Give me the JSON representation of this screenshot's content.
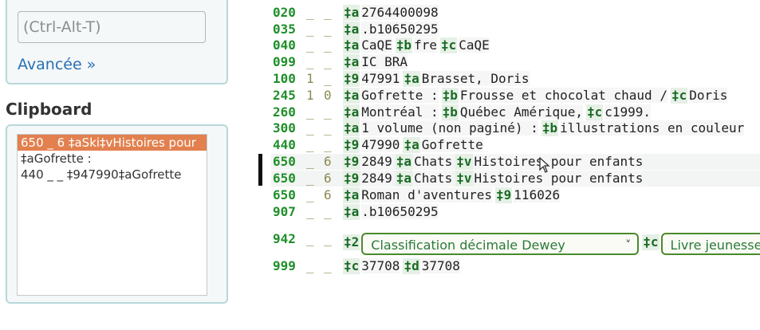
{
  "sidebar": {
    "search_placeholder": "(Ctrl-Alt-T)",
    "advanced_link": "Avancée »",
    "clipboard_title": "Clipboard",
    "clipboard_items": [
      "650 _ 6 ‡aSki‡vHistoires pour",
      "‡aGofrette :",
      "440 _ _ ‡947990‡aGofrette"
    ]
  },
  "editor": {
    "rows": [
      {
        "tag": "020",
        "ind1": "_",
        "ind2": "_",
        "subfields": [
          {
            "code": "‡a",
            "value": "2764400098"
          }
        ]
      },
      {
        "tag": "035",
        "ind1": "_",
        "ind2": "_",
        "subfields": [
          {
            "code": "‡a",
            "value": ".b10650295"
          }
        ]
      },
      {
        "tag": "040",
        "ind1": "_",
        "ind2": "_",
        "subfields": [
          {
            "code": "‡a",
            "value": "CaQE"
          },
          {
            "code": "‡b",
            "value": "fre"
          },
          {
            "code": "‡c",
            "value": "CaQE"
          }
        ]
      },
      {
        "tag": "099",
        "ind1": "_",
        "ind2": "_",
        "subfields": [
          {
            "code": "‡a",
            "value": "IC BRA"
          }
        ]
      },
      {
        "tag": "100",
        "ind1": "1",
        "ind2": "_",
        "subfields": [
          {
            "code": "‡9",
            "value": "47991"
          },
          {
            "code": "‡a",
            "value": "Brasset, Doris"
          }
        ]
      },
      {
        "tag": "245",
        "ind1": "1",
        "ind2": "0",
        "subfields": [
          {
            "code": "‡a",
            "value": "Gofrette :"
          },
          {
            "code": "‡b",
            "value": "Frousse et chocolat chaud /"
          },
          {
            "code": "‡c",
            "value": "Doris"
          }
        ]
      },
      {
        "tag": "260",
        "ind1": "_",
        "ind2": "_",
        "subfields": [
          {
            "code": "‡a",
            "value": "Montréal :"
          },
          {
            "code": "‡b",
            "value": "Québec Amérique,"
          },
          {
            "code": "‡c",
            "value": "c1999."
          }
        ]
      },
      {
        "tag": "300",
        "ind1": "_",
        "ind2": "_",
        "subfields": [
          {
            "code": "‡a",
            "value": "1 volume (non paginé) :"
          },
          {
            "code": "‡b",
            "value": "illustrations en couleur"
          }
        ]
      },
      {
        "tag": "440",
        "ind1": "_",
        "ind2": "_",
        "subfields": [
          {
            "code": "‡9",
            "value": "47990"
          },
          {
            "code": "‡a",
            "value": "Gofrette"
          }
        ]
      },
      {
        "tag": "650",
        "ind1": "_",
        "ind2": "6",
        "highlight": true,
        "subfields": [
          {
            "code": "‡9",
            "value": "2849"
          },
          {
            "code": "‡a",
            "value": "Chats"
          },
          {
            "code": "‡v",
            "value": "Histoires pour enfants"
          }
        ]
      },
      {
        "tag": "650",
        "ind1": "_",
        "ind2": "6",
        "highlight": true,
        "subfields": [
          {
            "code": "‡9",
            "value": "2849"
          },
          {
            "code": "‡a",
            "value": "Chats"
          },
          {
            "code": "‡v",
            "value": "Histoires pour enfants"
          }
        ]
      },
      {
        "tag": "650",
        "ind1": "_",
        "ind2": "6",
        "subfields": [
          {
            "code": "‡a",
            "value": "Roman d'aventures"
          },
          {
            "code": "‡9",
            "value": "116026"
          }
        ]
      },
      {
        "tag": "907",
        "ind1": "_",
        "ind2": "_",
        "subfields": [
          {
            "code": "‡a",
            "value": ".b10650295"
          }
        ]
      },
      {
        "tag": "942",
        "ind1": "_",
        "ind2": "_",
        "subfields": [
          {
            "code": "‡2",
            "value": ""
          },
          {
            "code": "‡c",
            "value": ""
          }
        ],
        "selects": [
          "Classification décimale Dewey",
          "Livre jeunesse"
        ]
      },
      {
        "tag": "999",
        "ind1": "_",
        "ind2": "_",
        "subfields": [
          {
            "code": "‡c",
            "value": "37708"
          },
          {
            "code": "‡d",
            "value": "37708"
          }
        ]
      }
    ]
  },
  "colors": {
    "tag": "#1f8f2a",
    "selection": "#e2804e",
    "link": "#2a6fb3",
    "box_border": "#b9d8d9",
    "select_border": "#4a8a2a"
  },
  "icons": {
    "cursor": "arrow-cursor-icon",
    "dropdown": "chevron-down-icon"
  }
}
